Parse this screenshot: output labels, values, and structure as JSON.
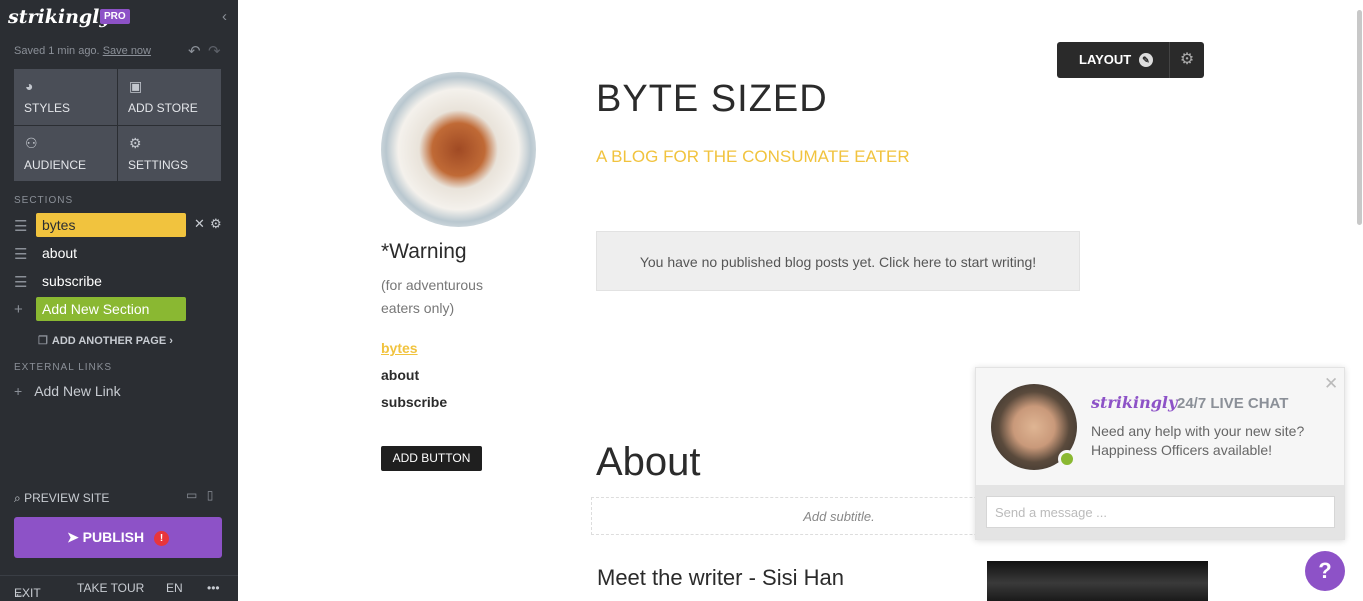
{
  "sidebar": {
    "logo": "strikingly",
    "pro_badge": "PRO",
    "saved_text": "Saved 1 min ago.",
    "save_now": "Save now",
    "tiles": [
      {
        "label": "STYLES",
        "icon": "palette-icon"
      },
      {
        "label": "ADD STORE",
        "icon": "store-icon"
      },
      {
        "label": "AUDIENCE",
        "icon": "users-icon"
      },
      {
        "label": "SETTINGS",
        "icon": "gear-icon"
      }
    ],
    "sections_heading": "SECTIONS",
    "sections": [
      {
        "label": "bytes",
        "active": true
      },
      {
        "label": "about",
        "active": false
      },
      {
        "label": "subscribe",
        "active": false
      }
    ],
    "add_section": "Add New Section",
    "add_page": "ADD ANOTHER PAGE",
    "external_links_heading": "EXTERNAL LINKS",
    "add_link": "Add New Link",
    "preview": "PREVIEW SITE",
    "publish": "PUBLISH",
    "bottom": {
      "exit": "EXIT",
      "tour": "TAKE TOUR",
      "lang": "EN",
      "more": "•••"
    }
  },
  "editor": {
    "layout_button": "LAYOUT"
  },
  "site": {
    "sidebar_heading": "*Warning",
    "sidebar_sub": "(for adventurous eaters only)",
    "nav": [
      "bytes",
      "about",
      "subscribe"
    ],
    "add_button": "ADD BUTTON",
    "title": "BYTE SIZED",
    "subtitle": "A BLOG FOR THE CONSUMATE EATER",
    "blog_empty": "You have no published blog posts yet. Click here to start writing!",
    "about_title": "About",
    "about_subtitle_placeholder": "Add subtitle.",
    "meet": "Meet the writer - Sisi Han"
  },
  "chat": {
    "brand": "strikingly",
    "live": "24/7 LIVE CHAT",
    "line1": "Need any help with your new site?",
    "line2": "Happiness Officers available!",
    "placeholder": "Send a message ..."
  },
  "help_button": "?",
  "colors": {
    "accent_purple": "#8d52c7",
    "active_yellow": "#f1c33e",
    "add_green": "#8ab832",
    "sidebar_bg": "#2b2e33"
  }
}
